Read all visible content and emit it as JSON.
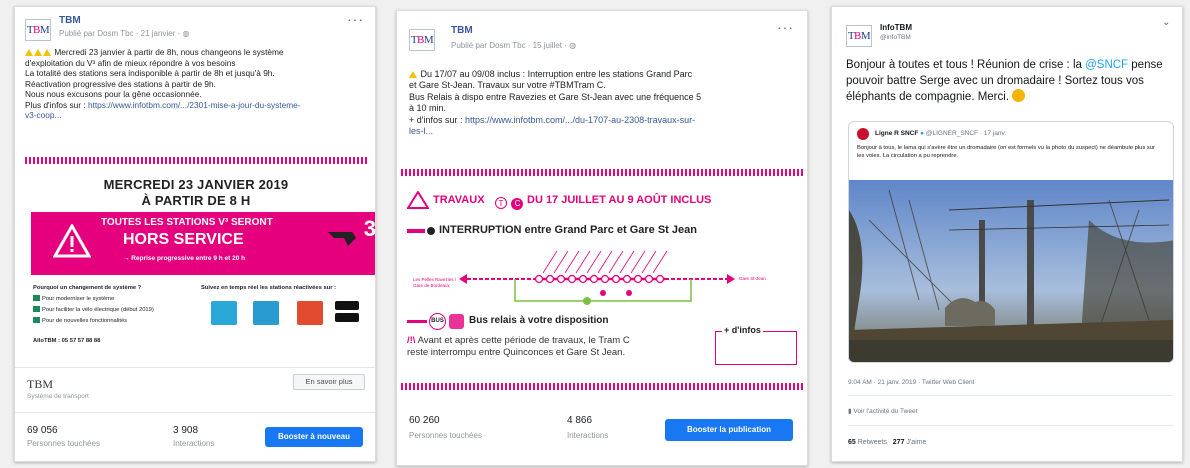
{
  "post1": {
    "page_name": "TBM",
    "meta": "Publié par Dosm Tbc · 21 janvier ·",
    "text_lines": [
      "Mercredi 23 janvier à partir de 8h, nous changeons le système",
      "d'exploitation du V³ afin de mieux répondre à vos besoins",
      "La totalité des stations sera indisponible à partir de 8h et jusqu'à 9h.",
      "Réactivation progressive des stations à partir de 9h.",
      "Nous nous excusons pour la gêne occasionnée.",
      "Plus d'infos sur :"
    ],
    "link_line": "https://www.infotbm.com/.../2301-mise-a-jour-du-systeme-",
    "link_line2": "v3-coop...",
    "img": {
      "date_line1": "MERCREDI 23 JANVIER 2019",
      "date_line2": "À PARTIR DE 8 H",
      "banner_line1": "TOUTES LES STATIONS V³ SERONT",
      "banner_line2": "HORS SERVICE",
      "banner_line3": "→ Reprise progressive entre 9 h et 20 h",
      "tram_number": "3",
      "left_heading": "Pourquoi un changement de système ?",
      "left_items": [
        "Pour moderniser le système",
        "Pour faciliter la vélo électrique (début 2019)",
        "Pour de nouvelles fonctionnalités"
      ],
      "right_heading": "Suivez en temps réel les stations réactivées sur :",
      "phone": "AlloTBM : 05 57 57 88 88"
    },
    "footer_name": "TBM",
    "footer_sub": "Système de transport",
    "cta": "En savoir plus",
    "reach_num": "69 056",
    "reach_label": "Personnes touchées",
    "inter_num": "3 908",
    "inter_label": "Interactions",
    "boost": "Booster à nouveau"
  },
  "post2": {
    "page_name": "TBM",
    "meta": "Publié par Dosm Tbc · 15 juillet ·",
    "text_lines": [
      "Du 17/07 au 09/08 inclus : Interruption entre les stations Grand Parc",
      "et Gare St-Jean. Travaux sur votre #TBMTram C.",
      "Bus Relais à dispo entre Ravezies et Gare St-Jean avec une fréquence 5",
      "à 10 min.",
      "+ d'infos sur :"
    ],
    "link": "https://www.infotbm.com/.../du-1707-au-2308-travaux-sur-",
    "link2": "les-l...",
    "img": {
      "title_a": "TRAVAUX",
      "title_b": "DU 17 JUILLET AU 9 AOÛT INCLUS",
      "interruption": "INTERRUPTION entre Grand Parc et Gare St Jean",
      "left_station": "Les Pelles Ravezies / Gare de Bordeaux",
      "right_station": "Gare St-Jean",
      "bus_text": "Bus relais à votre disposition",
      "note_line1": "Avant et après cette période de travaux, le Tram C",
      "note_line2": "reste interrompu entre Quinconces et Gare St Jean.",
      "infos_label": "+ d'infos"
    },
    "reach_num": "60 260",
    "reach_label": "Personnes touchées",
    "inter_num": "4 866",
    "inter_label": "Interactions",
    "boost": "Booster la publication"
  },
  "tweet": {
    "name": "InfoTBM",
    "handle": "@infoTBM",
    "text_before": "Bonjour à toutes et tous ! Réunion de crise : la ",
    "mention": "@SNCF",
    "text_after": " pense pouvoir battre Serge avec un dromadaire ! Sortez tous vos éléphants de compagnie. Merci.",
    "quote": {
      "name": "Ligne R SNCF",
      "handle": "@LIGNER_SNCF · 17 janv.",
      "text": "Bonjour à tous, le lama qui s'avère être un dromadaire (on est formels vu la photo du suspect) ne déambule plus sur les voies. La circulation a pu reprendre."
    },
    "time": "9:04 AM · 21 janv. 2019 · Twitter Web Client",
    "activity": "Voir l'activité du Tweet",
    "retweets_num": "65",
    "retweets_label": "Retweets",
    "likes_num": "277",
    "likes_label": "J'aime"
  }
}
